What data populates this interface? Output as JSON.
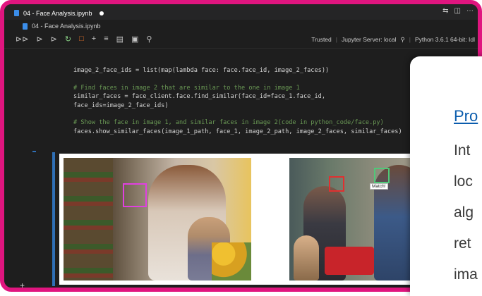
{
  "window": {
    "tab_title": "04 - Face Analysis.ipynb",
    "breadcrumb": "04 - Face Analysis.ipynb"
  },
  "toolbar": {
    "trusted": "Trusted",
    "server": "Jupyter Server: local",
    "kernel": "Python 3.6.1 64-bit: Idl"
  },
  "code_lines": [
    "image_2_face_ids = list(map(lambda face: face.face_id, image_2_faces))",
    "",
    "# Find faces in image 2 that are similar to the one in image 1",
    "similar_faces = face_client.face.find_similar(face_id=face_1.face_id,",
    "face_ids=image_2_face_ids)",
    "",
    "# Show the face in image 1, and similar faces in image 2(code in python_code/face.py)",
    "faces.show_similar_faces(image_1_path, face_1, image_2_path, image_2_faces, similar_faces)"
  ],
  "output": {
    "match_label": "Match!",
    "colors": {
      "face_box_1": "#e040e0",
      "face_box_2": "#e03030",
      "face_box_match": "#50c878"
    }
  },
  "card": {
    "link": "Pro",
    "lines": [
      "Int",
      "loc",
      "alg",
      "ret",
      "ima"
    ]
  },
  "accent": {
    "frame": "#e0157f",
    "cell_bar": "#2f6fb5"
  }
}
